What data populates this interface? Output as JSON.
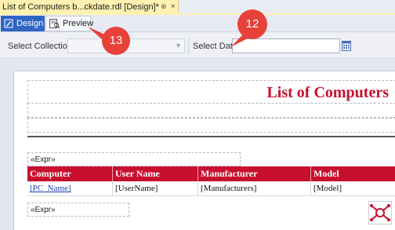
{
  "document_tab": {
    "title": "List of Computers b...ckdate.rdl [Design]*",
    "pin_glyph": "⊕",
    "close_glyph": "×"
  },
  "view_tabs": [
    {
      "label": "Design",
      "icon": "design-icon",
      "active": true
    },
    {
      "label": "Preview",
      "icon": "preview-icon",
      "active": false
    }
  ],
  "parameters": {
    "collection_label": "Select Collection",
    "collection_value": "",
    "date_label": "Select Date",
    "date_value": ""
  },
  "callouts": {
    "preview": "13",
    "date": "12"
  },
  "report": {
    "title": "List of Computers",
    "expression_top": "«Expr»",
    "expression_bottom": "«Expr»",
    "columns": [
      "Computer",
      "User Name",
      "Manufacturer",
      "Model"
    ],
    "detail_row": [
      "[PC_Name]",
      "[UserName]",
      "[Manufacturers]",
      "[Model]"
    ]
  },
  "colors": {
    "accent_red": "#c8102e",
    "tab_blue": "#2f66c4",
    "doc_tab_yellow": "#fff1b0",
    "callout_red": "#e8413a"
  }
}
